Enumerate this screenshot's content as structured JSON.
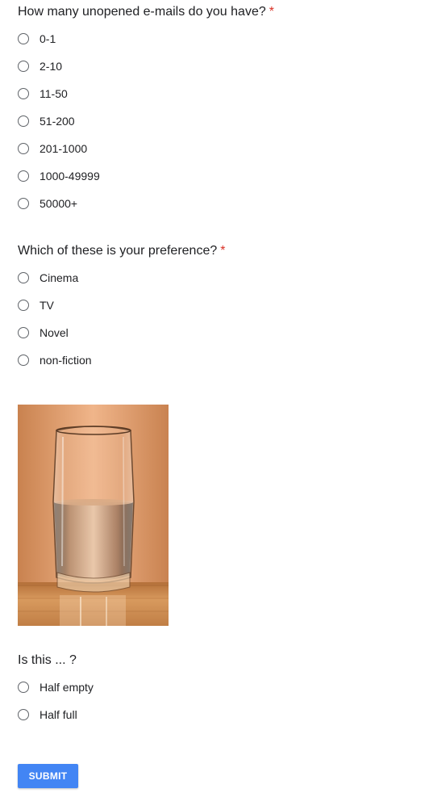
{
  "questions": [
    {
      "title": "How many unopened e-mails do you have?",
      "required_mark": "*",
      "options": [
        "0-1",
        "2-10",
        "11-50",
        "51-200",
        "201-1000",
        "1000-49999",
        "50000+"
      ]
    },
    {
      "title": "Which of these is your preference?",
      "required_mark": "*",
      "options": [
        "Cinema",
        "TV",
        "Novel",
        "non-fiction"
      ]
    },
    {
      "title": "Is this ... ?",
      "options": [
        "Half empty",
        "Half full"
      ]
    }
  ],
  "image": {
    "subject": "glass-of-water"
  },
  "submit": {
    "label": "SUBMIT"
  },
  "colors": {
    "required": "#d93025",
    "submit_bg": "#4285f4",
    "text": "#202124",
    "radio_border": "#5f6368"
  }
}
